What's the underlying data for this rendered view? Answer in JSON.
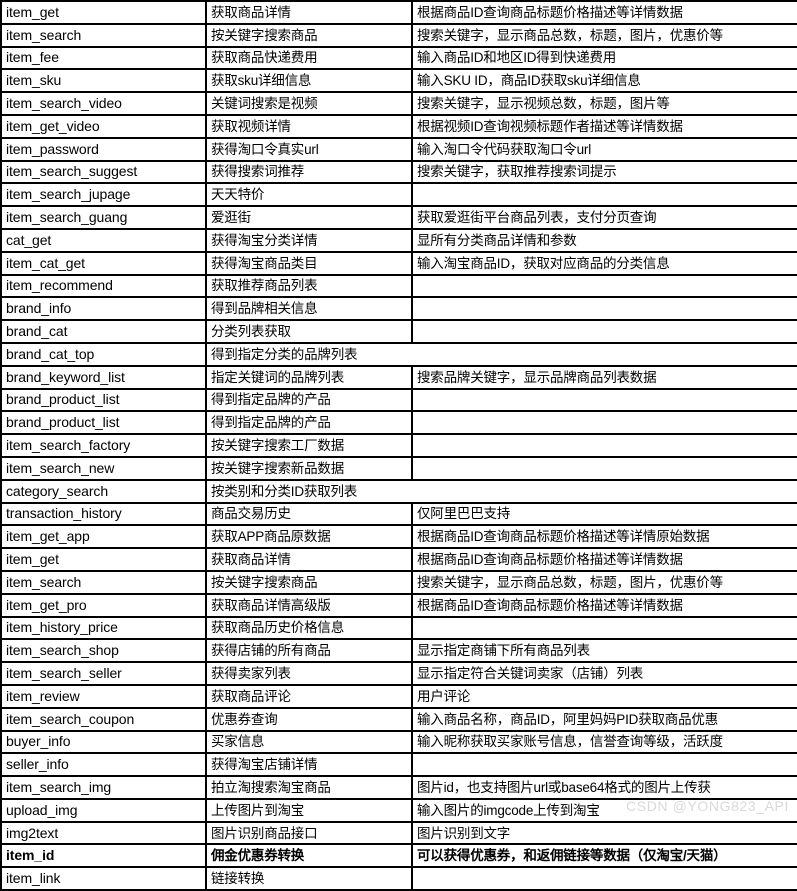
{
  "document": {
    "type": "api-interface-table",
    "watermark": "CSDN @YONG823_API",
    "columns": 3
  },
  "table": {
    "rows": [
      {
        "name": "item_get",
        "title": "获取商品详情",
        "desc": "根据商品ID查询商品标题价格描述等详情数据",
        "merged": false,
        "bold": false
      },
      {
        "name": "item_search",
        "title": "按关键字搜索商品",
        "desc": "搜索关键字，显示商品总数，标题，图片，优惠价等",
        "merged": false,
        "bold": false
      },
      {
        "name": "item_fee",
        "title": "获取商品快递费用",
        "desc": "输入商品ID和地区ID得到快递费用",
        "merged": false,
        "bold": false
      },
      {
        "name": "item_sku",
        "title": "获取sku详细信息",
        "desc": "输入SKU ID，商品ID获取sku详细信息",
        "merged": false,
        "bold": false
      },
      {
        "name": "item_search_video",
        "title": "关键词搜索是视频",
        "desc": "搜索关键字，显示视频总数，标题，图片等",
        "merged": false,
        "bold": false
      },
      {
        "name": "item_get_video",
        "title": "获取视频详情",
        "desc": "根据视频ID查询视频标题作者描述等详情数据",
        "merged": false,
        "bold": false
      },
      {
        "name": "item_password",
        "title": "获得淘口令真实url",
        "desc": "输入淘口令代码获取淘口令url",
        "merged": false,
        "bold": false
      },
      {
        "name": "item_search_suggest",
        "title": "获得搜索词推荐",
        "desc": "搜索关键字，获取推荐搜索词提示",
        "merged": false,
        "bold": false
      },
      {
        "name": "item_search_jupage",
        "title": "天天特价",
        "desc": "",
        "merged": false,
        "bold": false
      },
      {
        "name": "item_search_guang",
        "title": "爱逛街",
        "desc": "获取爱逛街平台商品列表，支付分页查询",
        "merged": false,
        "bold": false
      },
      {
        "name": "cat_get",
        "title": "获得淘宝分类详情",
        "desc": "显所有分类商品详情和参数",
        "merged": false,
        "bold": false
      },
      {
        "name": "item_cat_get",
        "title": "获得淘宝商品类目",
        "desc": "输入淘宝商品ID，获取对应商品的分类信息",
        "merged": false,
        "bold": false
      },
      {
        "name": "item_recommend",
        "title": "获取推荐商品列表",
        "desc": "",
        "merged": false,
        "bold": false
      },
      {
        "name": "brand_info",
        "title": "得到品牌相关信息",
        "desc": "",
        "merged": false,
        "bold": false
      },
      {
        "name": "brand_cat",
        "title": "分类列表获取",
        "desc": "",
        "merged": false,
        "bold": false
      },
      {
        "name": "brand_cat_top",
        "title": "得到指定分类的品牌列表",
        "desc": "",
        "merged": true,
        "bold": false
      },
      {
        "name": "brand_keyword_list",
        "title": "指定关键词的品牌列表",
        "desc": "搜索品牌关键字，显示品牌商品列表数据",
        "merged": false,
        "bold": false
      },
      {
        "name": "brand_product_list",
        "title": "得到指定品牌的产品",
        "desc": "",
        "merged": false,
        "bold": false
      },
      {
        "name": "brand_product_list",
        "title": "得到指定品牌的产品",
        "desc": "",
        "merged": false,
        "bold": false
      },
      {
        "name": "item_search_factory",
        "title": "按关键字搜索工厂数据",
        "desc": "",
        "merged": false,
        "bold": false
      },
      {
        "name": "item_search_new",
        "title": "按关键字搜索新品数据",
        "desc": "",
        "merged": false,
        "bold": false
      },
      {
        "name": "category_search",
        "title": "按类别和分类ID获取列表",
        "desc": "",
        "merged": true,
        "bold": false
      },
      {
        "name": "transaction_history",
        "title": "商品交易历史",
        "desc": "仅阿里巴巴支持",
        "merged": false,
        "bold": false
      },
      {
        "name": "item_get_app",
        "title": "获取APP商品原数据",
        "desc": "根据商品ID查询商品标题价格描述等详情原始数据",
        "merged": false,
        "bold": false
      },
      {
        "name": "item_get",
        "title": "获取商品详情",
        "desc": "根据商品ID查询商品标题价格描述等详情数据",
        "merged": false,
        "bold": false
      },
      {
        "name": "item_search",
        "title": "按关键字搜索商品",
        "desc": "搜索关键字，显示商品总数，标题，图片，优惠价等",
        "merged": false,
        "bold": false
      },
      {
        "name": "item_get_pro",
        "title": "获取商品详情高级版",
        "desc": "根据商品ID查询商品标题价格描述等详情数据",
        "merged": false,
        "bold": false
      },
      {
        "name": "item_history_price",
        "title": "获取商品历史价格信息",
        "desc": "",
        "merged": false,
        "bold": false
      },
      {
        "name": "item_search_shop",
        "title": "获得店铺的所有商品",
        "desc": "显示指定商铺下所有商品列表",
        "merged": false,
        "bold": false
      },
      {
        "name": "item_search_seller",
        "title": "获得卖家列表",
        "desc": "显示指定符合关键词卖家（店铺）列表",
        "merged": false,
        "bold": false
      },
      {
        "name": "item_review",
        "title": "获取商品评论",
        "desc": "用户评论",
        "merged": false,
        "bold": false
      },
      {
        "name": "item_search_coupon",
        "title": "优惠券查询",
        "desc": "输入商品名称，商品ID，阿里妈妈PID获取商品优惠",
        "merged": false,
        "bold": false
      },
      {
        "name": "buyer_info",
        "title": "买家信息",
        "desc": "输入昵称获取买家账号信息，信誉查询等级，活跃度",
        "merged": false,
        "bold": false
      },
      {
        "name": "seller_info",
        "title": "获得淘宝店铺详情",
        "desc": "",
        "merged": false,
        "bold": false
      },
      {
        "name": "item_search_img",
        "title": "拍立淘搜索淘宝商品",
        "desc": "图片id，也支持图片url或base64格式的图片上传获",
        "merged": false,
        "bold": false
      },
      {
        "name": "upload_img",
        "title": "上传图片到淘宝",
        "desc": "输入图片的imgcode上传到淘宝",
        "merged": false,
        "bold": false
      },
      {
        "name": "img2text",
        "title": "图片识别商品接口",
        "desc": "图片识别到文字",
        "merged": false,
        "bold": false
      },
      {
        "name": "item_id",
        "title": "佣金优惠券转换",
        "desc": "可以获得优惠券，和返佣链接等数据（仅淘宝/天猫）",
        "merged": false,
        "bold": true
      },
      {
        "name": "item_link",
        "title": "链接转换",
        "desc": "",
        "merged": false,
        "bold": false
      }
    ]
  }
}
